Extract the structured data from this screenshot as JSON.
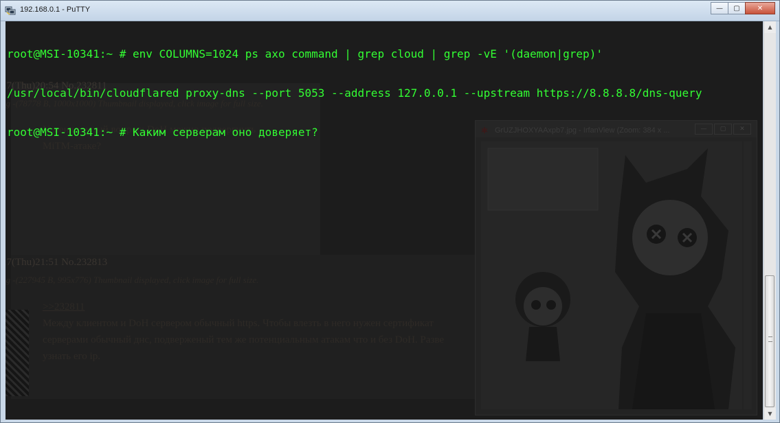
{
  "window": {
    "title": "192.168.0.1 - PuTTY",
    "icon": "putty-icon",
    "controls": {
      "minimize": "—",
      "maximize": "▢",
      "close": "✕"
    }
  },
  "terminal": {
    "lines": [
      "root@MSI-10341:~ # env COLUMNS=1024 ps axo command | grep cloud | grep -vE '(daemon|grep)'",
      "/usr/local/bin/cloudflared proxy-dns --port 5053 --address 127.0.0.1 --upstream https://8.8.8.8/dns-query",
      "root@MSI-10341:~ # Каким серверам оно доверяет?"
    ],
    "text_color": "#33ff33",
    "background_color": "#1c1c1c"
  },
  "background_forum": {
    "post1": {
      "meta": "17(Thu)20:54 No.232811",
      "file": "ng -(78778 B, 1000x1000) Thumbnail displayed, click image for full size.",
      "text_line1": "У меня глупый вопрос: DoH можно подвергнуть",
      "text_line2": "MiTM-атаке?"
    },
    "post2": {
      "meta": "17(Thu)21:51 No.232813",
      "file": "ng -(227945 B, 995x776) Thumbnail displayed, click image for full size.",
      "reply_link": ">>232811",
      "text_line1": "Между клиентом и DoH сервером обычный https. Чтобы влезть в него нужен сертификат",
      "text_line2": "серверами обычный днс, подверженый тем же потенциальным атакам что и без DoH. Разве",
      "text_line3": "узнать его ip."
    }
  },
  "irfanview": {
    "title": "GrUZJHOXYAAxpb7.jpg - IrfanView (Zoom: 384 x ...",
    "icon": "irfanview-icon",
    "controls": {
      "minimize": "—",
      "maximize": "▢",
      "close": "✕"
    }
  }
}
